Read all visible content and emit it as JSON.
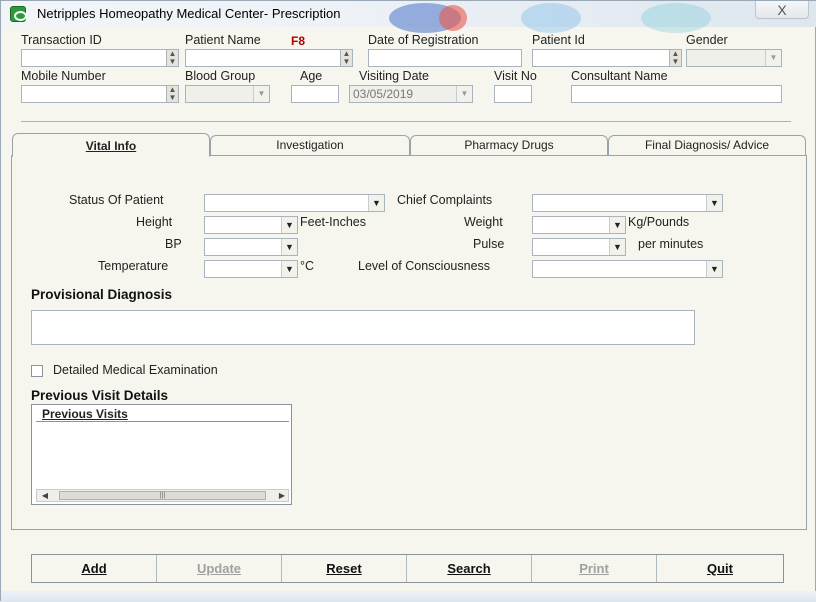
{
  "window": {
    "title": "Netripples Homeopathy Medical Center- Prescription",
    "close_label": "X"
  },
  "header": {
    "transaction_id": {
      "label": "Transaction ID",
      "value": ""
    },
    "patient_name": {
      "label": "Patient Name",
      "hint": "F8",
      "value": ""
    },
    "date_of_registration": {
      "label": "Date of Registration",
      "value": ""
    },
    "patient_id": {
      "label": "Patient Id",
      "value": ""
    },
    "gender": {
      "label": "Gender",
      "value": ""
    },
    "mobile_number": {
      "label": "Mobile Number",
      "value": ""
    },
    "blood_group": {
      "label": "Blood Group",
      "value": ""
    },
    "age": {
      "label": "Age",
      "value": ""
    },
    "visiting_date": {
      "label": "Visiting Date",
      "value": "03/05/2019"
    },
    "visit_no": {
      "label": "Visit No",
      "value": ""
    },
    "consultant_name": {
      "label": "Consultant Name",
      "value": ""
    }
  },
  "tabs": [
    {
      "label": "Vital Info",
      "active": true
    },
    {
      "label": "Investigation",
      "active": false
    },
    {
      "label": "Pharmacy Drugs",
      "active": false
    },
    {
      "label": "Final Diagnosis/ Advice",
      "active": false
    }
  ],
  "vitals": {
    "status_of_patient": {
      "label": "Status Of Patient",
      "value": ""
    },
    "chief_complaints": {
      "label": "Chief Complaints",
      "value": ""
    },
    "height": {
      "label": "Height",
      "unit": "Feet-Inches",
      "value": ""
    },
    "weight": {
      "label": "Weight",
      "unit": "Kg/Pounds",
      "value": ""
    },
    "bp": {
      "label": "BP",
      "value": ""
    },
    "pulse": {
      "label": "Pulse",
      "unit": "per minutes",
      "value": ""
    },
    "temperature": {
      "label": "Temperature",
      "unit": "°C",
      "value": ""
    },
    "level_of_consciousness": {
      "label": "Level of Consciousness",
      "value": ""
    }
  },
  "provisional_diagnosis": {
    "title": "Provisional Diagnosis",
    "value": ""
  },
  "detailed_exam": {
    "label": "Detailed Medical  Examination",
    "checked": false
  },
  "previous_visit": {
    "title": "Previous Visit Details",
    "column": "Previous Visits",
    "rows": []
  },
  "buttons": [
    {
      "label": "Add",
      "enabled": true
    },
    {
      "label": "Update",
      "enabled": false
    },
    {
      "label": "Reset",
      "enabled": true
    },
    {
      "label": "Search",
      "enabled": true
    },
    {
      "label": "Print",
      "enabled": false
    },
    {
      "label": "Quit",
      "enabled": true
    }
  ],
  "colors": {
    "window_bg": "#f6f6ee",
    "required_hint": "#b00000",
    "border": "#a9b3bd"
  }
}
